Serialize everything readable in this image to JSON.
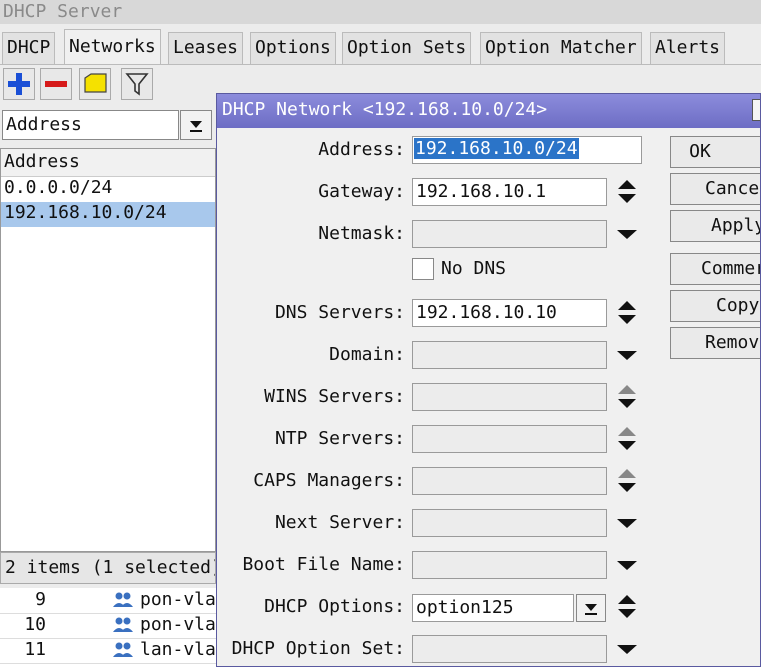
{
  "window": {
    "title": "DHCP Server"
  },
  "tabs": [
    "DHCP",
    "Networks",
    "Leases",
    "Options",
    "Option Sets",
    "Option Matcher",
    "Alerts"
  ],
  "toolbar": {
    "icons": [
      "plus-icon",
      "minus-icon",
      "comment-icon",
      "filter-icon"
    ],
    "colors": {
      "plus": "#1a4fd6",
      "minus": "#d61a1a",
      "comment": "#f5e100"
    }
  },
  "filter": {
    "field": "Address"
  },
  "list": {
    "header": "Address",
    "rows": [
      {
        "address": "0.0.0.0/24",
        "selected": false
      },
      {
        "address": "192.168.10.0/24",
        "selected": true
      }
    ],
    "status": "2 items (1 selected)"
  },
  "bottom_table": {
    "rows": [
      {
        "num": "9",
        "name": "pon-vla"
      },
      {
        "num": "10",
        "name": "pon-vla"
      },
      {
        "num": "11",
        "name": "lan-vla"
      }
    ]
  },
  "dialog": {
    "title": "DHCP Network <192.168.10.0/24>",
    "fields": {
      "address": {
        "label": "Address:",
        "value": "192.168.10.0/24"
      },
      "gateway": {
        "label": "Gateway:",
        "value": "192.168.10.1"
      },
      "netmask": {
        "label": "Netmask:",
        "value": ""
      },
      "no_dns": {
        "label": "No DNS",
        "checked": false
      },
      "dns_servers": {
        "label": "DNS Servers:",
        "value": "192.168.10.10"
      },
      "domain": {
        "label": "Domain:",
        "value": ""
      },
      "wins_servers": {
        "label": "WINS Servers:",
        "value": ""
      },
      "ntp_servers": {
        "label": "NTP Servers:",
        "value": ""
      },
      "caps_managers": {
        "label": "CAPS Managers:",
        "value": ""
      },
      "next_server": {
        "label": "Next Server:",
        "value": ""
      },
      "boot_file_name": {
        "label": "Boot File Name:",
        "value": ""
      },
      "dhcp_options": {
        "label": "DHCP Options:",
        "value": "option125"
      },
      "dhcp_option_set": {
        "label": "DHCP Option Set:",
        "value": ""
      }
    },
    "buttons": {
      "ok": "OK",
      "cancel": "Cance",
      "apply": "Apply",
      "comment": "Commer",
      "copy": "Copy",
      "remove": "Remov"
    },
    "selection_color": "#2b74c8",
    "title_color": "#7b7bd0"
  }
}
